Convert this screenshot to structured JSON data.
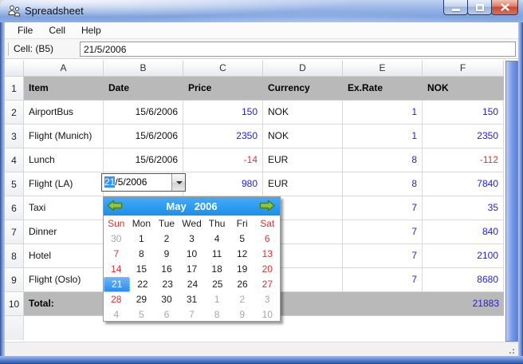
{
  "window": {
    "title": "Spreadsheet"
  },
  "menu": {
    "items": [
      {
        "label": "File"
      },
      {
        "label": "Cell"
      },
      {
        "label": "Help"
      }
    ]
  },
  "toolbar": {
    "cell_label": "Cell: (B5)",
    "cell_value": "21/5/2006"
  },
  "table": {
    "column_headers": [
      "A",
      "B",
      "C",
      "D",
      "E",
      "F"
    ],
    "rows": [
      {
        "n": "1",
        "kind": "band",
        "cells": [
          {
            "t": "Item",
            "k": "head"
          },
          {
            "t": "Date",
            "k": "head"
          },
          {
            "t": "Price",
            "k": "head"
          },
          {
            "t": "Currency",
            "k": "head"
          },
          {
            "t": "Ex.Rate",
            "k": "head"
          },
          {
            "t": "NOK",
            "k": "head"
          }
        ]
      },
      {
        "n": "2",
        "kind": "normal",
        "cells": [
          {
            "t": "AirportBus",
            "k": "text"
          },
          {
            "t": "15/6/2006",
            "k": "date"
          },
          {
            "t": "150",
            "k": "pos"
          },
          {
            "t": "NOK",
            "k": "cur"
          },
          {
            "t": "1",
            "k": "pos"
          },
          {
            "t": "150",
            "k": "pos"
          }
        ]
      },
      {
        "n": "3",
        "kind": "normal",
        "cells": [
          {
            "t": "Flight (Munich)",
            "k": "text"
          },
          {
            "t": "15/6/2006",
            "k": "date"
          },
          {
            "t": "2350",
            "k": "pos"
          },
          {
            "t": "NOK",
            "k": "cur"
          },
          {
            "t": "1",
            "k": "pos"
          },
          {
            "t": "2350",
            "k": "pos"
          }
        ]
      },
      {
        "n": "4",
        "kind": "normal",
        "cells": [
          {
            "t": "Lunch",
            "k": "text"
          },
          {
            "t": "15/6/2006",
            "k": "date"
          },
          {
            "t": "-14",
            "k": "neg"
          },
          {
            "t": "EUR",
            "k": "cur"
          },
          {
            "t": "8",
            "k": "pos"
          },
          {
            "t": "-112",
            "k": "neg"
          }
        ]
      },
      {
        "n": "5",
        "kind": "normal",
        "cells": [
          {
            "t": "Flight (LA)",
            "k": "text"
          },
          {
            "t": "",
            "k": "date"
          },
          {
            "t": "980",
            "k": "pos"
          },
          {
            "t": "EUR",
            "k": "cur"
          },
          {
            "t": "8",
            "k": "pos"
          },
          {
            "t": "7840",
            "k": "pos"
          }
        ]
      },
      {
        "n": "6",
        "kind": "normal",
        "cells": [
          {
            "t": "Taxi",
            "k": "text"
          },
          {
            "t": "",
            "k": "date"
          },
          {
            "t": "",
            "k": "pos"
          },
          {
            "t": "",
            "k": "cur"
          },
          {
            "t": "7",
            "k": "pos"
          },
          {
            "t": "35",
            "k": "pos"
          }
        ]
      },
      {
        "n": "7",
        "kind": "normal",
        "cells": [
          {
            "t": "Dinner",
            "k": "text"
          },
          {
            "t": "",
            "k": "date"
          },
          {
            "t": "",
            "k": "pos"
          },
          {
            "t": "",
            "k": "cur"
          },
          {
            "t": "7",
            "k": "pos"
          },
          {
            "t": "840",
            "k": "pos"
          }
        ]
      },
      {
        "n": "8",
        "kind": "normal",
        "cells": [
          {
            "t": "Hotel",
            "k": "text"
          },
          {
            "t": "",
            "k": "date"
          },
          {
            "t": "",
            "k": "pos"
          },
          {
            "t": "",
            "k": "cur"
          },
          {
            "t": "7",
            "k": "pos"
          },
          {
            "t": "2100",
            "k": "pos"
          }
        ]
      },
      {
        "n": "9",
        "kind": "normal",
        "cells": [
          {
            "t": "Flight (Oslo)",
            "k": "text"
          },
          {
            "t": "",
            "k": "date"
          },
          {
            "t": "",
            "k": "pos"
          },
          {
            "t": "",
            "k": "cur"
          },
          {
            "t": "7",
            "k": "pos"
          },
          {
            "t": "8680",
            "k": "pos"
          }
        ]
      },
      {
        "n": "10",
        "kind": "band",
        "cells": [
          {
            "t": "Total:",
            "k": "head"
          },
          {
            "t": "",
            "k": "date"
          },
          {
            "t": "",
            "k": "pos"
          },
          {
            "t": "",
            "k": "cur"
          },
          {
            "t": "",
            "k": "pos"
          },
          {
            "t": "21883",
            "k": "pos"
          }
        ]
      }
    ]
  },
  "editor": {
    "selected_part": "21",
    "rest_part": "/5/2006"
  },
  "calendar": {
    "month": "May",
    "year": "2006",
    "day_names": [
      {
        "t": "Sun",
        "k": "wk"
      },
      {
        "t": "Mon",
        "k": "d"
      },
      {
        "t": "Tue",
        "k": "d"
      },
      {
        "t": "Wed",
        "k": "d"
      },
      {
        "t": "Thu",
        "k": "d"
      },
      {
        "t": "Fri",
        "k": "d"
      },
      {
        "t": "Sat",
        "k": "wk"
      }
    ],
    "weeks": [
      [
        {
          "t": "30",
          "k": "o"
        },
        {
          "t": "1",
          "k": "d"
        },
        {
          "t": "2",
          "k": "d"
        },
        {
          "t": "3",
          "k": "d"
        },
        {
          "t": "4",
          "k": "d"
        },
        {
          "t": "5",
          "k": "d"
        },
        {
          "t": "6",
          "k": "w"
        }
      ],
      [
        {
          "t": "7",
          "k": "w"
        },
        {
          "t": "8",
          "k": "d"
        },
        {
          "t": "9",
          "k": "d"
        },
        {
          "t": "10",
          "k": "d"
        },
        {
          "t": "11",
          "k": "d"
        },
        {
          "t": "12",
          "k": "d"
        },
        {
          "t": "13",
          "k": "w"
        }
      ],
      [
        {
          "t": "14",
          "k": "w"
        },
        {
          "t": "15",
          "k": "d"
        },
        {
          "t": "16",
          "k": "d"
        },
        {
          "t": "17",
          "k": "d"
        },
        {
          "t": "18",
          "k": "d"
        },
        {
          "t": "19",
          "k": "d"
        },
        {
          "t": "20",
          "k": "w"
        }
      ],
      [
        {
          "t": "21",
          "k": "s"
        },
        {
          "t": "22",
          "k": "d"
        },
        {
          "t": "23",
          "k": "d"
        },
        {
          "t": "24",
          "k": "d"
        },
        {
          "t": "25",
          "k": "d"
        },
        {
          "t": "26",
          "k": "d"
        },
        {
          "t": "27",
          "k": "w"
        }
      ],
      [
        {
          "t": "28",
          "k": "w"
        },
        {
          "t": "29",
          "k": "d"
        },
        {
          "t": "30",
          "k": "d"
        },
        {
          "t": "31",
          "k": "d"
        },
        {
          "t": "1",
          "k": "o"
        },
        {
          "t": "2",
          "k": "o"
        },
        {
          "t": "3",
          "k": "o"
        }
      ],
      [
        {
          "t": "4",
          "k": "o"
        },
        {
          "t": "5",
          "k": "o"
        },
        {
          "t": "6",
          "k": "o"
        },
        {
          "t": "7",
          "k": "o"
        },
        {
          "t": "8",
          "k": "o"
        },
        {
          "t": "9",
          "k": "o"
        },
        {
          "t": "10",
          "k": "o"
        }
      ]
    ],
    "selected_date": "21"
  },
  "colors": {
    "value_positive": "#1e1ee0",
    "value_negative": "#e23434",
    "band_gray": "#b9b9b9",
    "calendar_header_blue": "#2d9cf0",
    "selected_day_blue": "#2f8be9",
    "weekend_red": "#dd3333",
    "frame_blue": "#6f95ea"
  }
}
